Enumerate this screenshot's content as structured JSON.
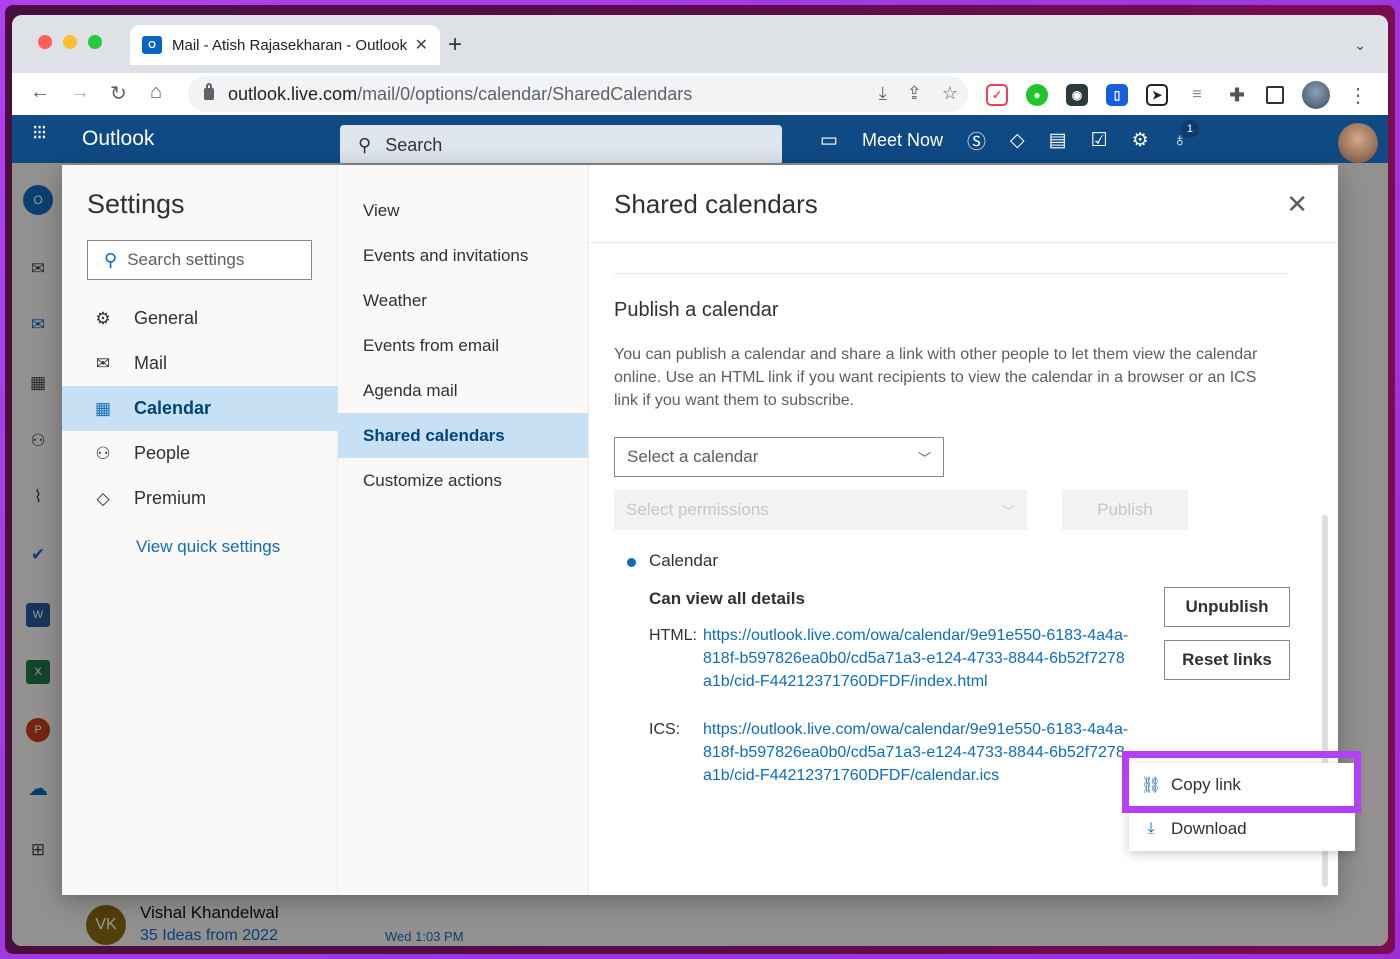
{
  "browser": {
    "tab_title": "Mail - Atish Rajasekharan - Outlook",
    "tab_favicon": "O",
    "url_host": "outlook.live.com",
    "url_path": "/mail/0/options/calendar/SharedCalendars",
    "new_tab": "+",
    "tabs_chevron": "⌄",
    "back": "←",
    "forward": "→",
    "reload": "↻",
    "home": "⌂",
    "omni_icons": [
      "⤓",
      "⇪",
      "☆"
    ],
    "kebab": "⋮"
  },
  "outlook": {
    "brand": "Outlook",
    "waffle": "⋮⋮⋮",
    "search_placeholder": "Search",
    "meet_now": "Meet Now",
    "tips_badge": "1"
  },
  "behind_list": {
    "sender_initials": "VK",
    "sender": "Vishal Khandelwal",
    "subject": "35 Ideas from 2022",
    "time": "Wed 1:03 PM"
  },
  "settings": {
    "title": "Settings",
    "search_placeholder": "Search settings",
    "categories": [
      {
        "label": "General",
        "icon": "gear-icon",
        "glyph": "⚙"
      },
      {
        "label": "Mail",
        "icon": "mail-icon",
        "glyph": "✉"
      },
      {
        "label": "Calendar",
        "icon": "calendar-icon",
        "glyph": "▦",
        "active": true
      },
      {
        "label": "People",
        "icon": "people-icon",
        "glyph": "⚇"
      },
      {
        "label": "Premium",
        "icon": "diamond-icon",
        "glyph": "◇"
      }
    ],
    "quick_settings_link": "View quick settings",
    "calendar_subitems": [
      {
        "label": "View"
      },
      {
        "label": "Events and invitations"
      },
      {
        "label": "Weather"
      },
      {
        "label": "Events from email"
      },
      {
        "label": "Agenda mail"
      },
      {
        "label": "Shared calendars",
        "active": true
      },
      {
        "label": "Customize actions"
      }
    ]
  },
  "shared_calendars": {
    "title": "Shared calendars",
    "close": "✕",
    "publish_section_title": "Publish a calendar",
    "publish_description": "You can publish a calendar and share a link with other people to let them view the calendar online. Use an HTML link if you want recipients to view the calendar in a browser or an ICS link if you want them to subscribe.",
    "select_calendar_placeholder": "Select a calendar",
    "select_permissions_placeholder": "Select permissions",
    "publish_button": "Publish",
    "published": {
      "calendar_name": "Calendar",
      "permission": "Can view all details",
      "html_label": "HTML:",
      "html_url": "https://outlook.live.com/owa/calendar/9e91e550-6183-4a4a-818f-b597826ea0b0/cd5a71a3-e124-4733-8844-6b52f7278a1b/cid-F44212371760DFDF/index.html",
      "ics_label": "ICS:",
      "ics_url": "https://outlook.live.com/owa/calendar/9e91e550-6183-4a4a-818f-b597826ea0b0/cd5a71a3-e124-4733-8844-6b52f7278a1b/cid-F44212371760DFDF/calendar.ics",
      "unpublish_button": "Unpublish",
      "reset_links_button": "Reset links"
    }
  },
  "context_menu": {
    "items": [
      {
        "label": "Copy link",
        "icon": "link-icon",
        "glyph": "⊂⊃",
        "highlighted": true
      },
      {
        "label": "Download",
        "icon": "download-icon",
        "glyph": "⤓"
      }
    ]
  },
  "colors": {
    "accent": "#0f6cbd",
    "header": "#0f4a85",
    "selected": "#c7e0f4",
    "highlight": "#b340f5"
  }
}
